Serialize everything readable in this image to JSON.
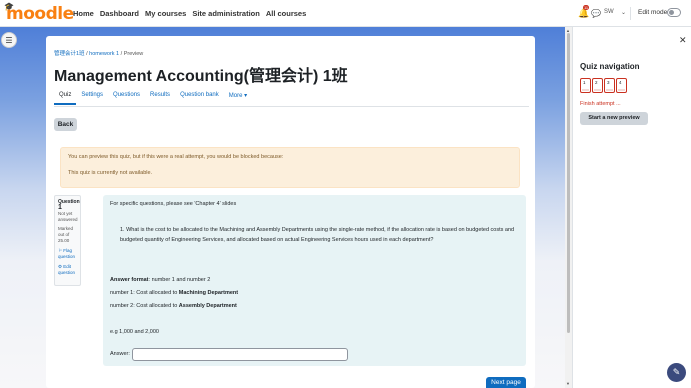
{
  "navbar": {
    "brand": "moodle",
    "links": [
      "Home",
      "Dashboard",
      "My courses",
      "Site administration",
      "All courses"
    ],
    "notification_count": "11",
    "user_initials": "SW",
    "edit_mode_label": "Edit mode"
  },
  "breadcrumb": {
    "course": "管理会计1班",
    "activity": "homework 1",
    "current": "Preview"
  },
  "page": {
    "title": "Management Accounting(管理会计) 1班"
  },
  "tabs": [
    "Quiz",
    "Settings",
    "Questions",
    "Results",
    "Question bank",
    "More ▾"
  ],
  "back_label": "Back",
  "alert": {
    "line1": "You can preview this quiz, but if this were a real attempt, you would be blocked because:",
    "line2": "This quiz is currently not available."
  },
  "question_info": {
    "label": "Question",
    "number": "1",
    "status_1": "Not yet",
    "status_2": "answered",
    "marks_1": "Marked out of",
    "marks_2": "25.00",
    "flag_label": "Flag question",
    "edit_label": "Edit question"
  },
  "question": {
    "intro": "For specific questions, please see 'Chapter 4' slides",
    "item": "1. What is the cost to be allocated to the Machining and Assembly Departments using the single-rate method, if the allocation rate is based on budgeted costs and budgeted quantity of Engineering Services, and allocated based on actual Engineering Services hours used in each department?",
    "format_label": "Answer format",
    "format_value": ": number 1 and number 2",
    "n1_prefix": "number 1: Cost allocated to ",
    "n1_bold": "Machining Department",
    "n2_prefix": "number 2: Cost allocated to ",
    "n2_bold": "Assembly Department",
    "example": "e.g 1,000 and 2,000",
    "answer_label": "Answer:",
    "answer_value": ""
  },
  "next_label": "Next page",
  "quiz_nav": {
    "title": "Quiz navigation",
    "buttons": [
      "1",
      "2",
      "3",
      "4"
    ],
    "finish_label": "Finish attempt ...",
    "new_preview_label": "Start a new preview"
  }
}
